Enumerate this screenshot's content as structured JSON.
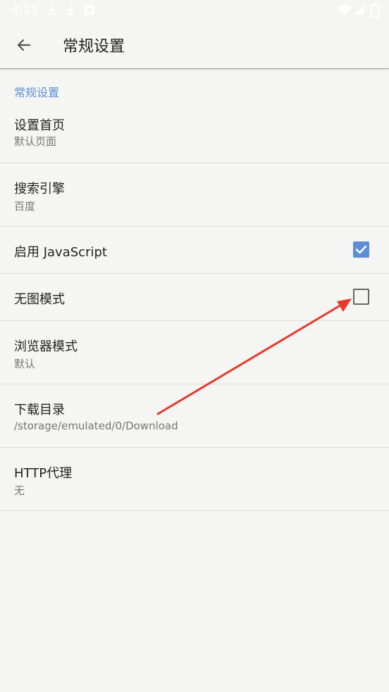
{
  "status_bar": {
    "time": "4:13",
    "icons": [
      "download-icon",
      "download-icon",
      "app-notification-icon",
      "wifi-icon",
      "signal-icon",
      "battery-icon"
    ]
  },
  "toolbar": {
    "back_icon": "arrow-left-icon",
    "title": "常规设置"
  },
  "section": {
    "header": "常规设置"
  },
  "preferences": [
    {
      "title": "设置首页",
      "summary": "默认页面"
    },
    {
      "title": "搜索引擎",
      "summary": "百度"
    },
    {
      "title": "启用 JavaScript",
      "checked": true
    },
    {
      "title": "无图模式",
      "checked": false
    },
    {
      "title": "浏览器模式",
      "summary": "默认"
    },
    {
      "title": "下载目录",
      "summary": "/storage/emulated/0/Download"
    },
    {
      "title": "HTTP代理",
      "summary": "无"
    }
  ],
  "colors": {
    "accent": "#5c8fd6",
    "background": "#f5f6f4",
    "annotation_arrow": "#e8392b"
  }
}
